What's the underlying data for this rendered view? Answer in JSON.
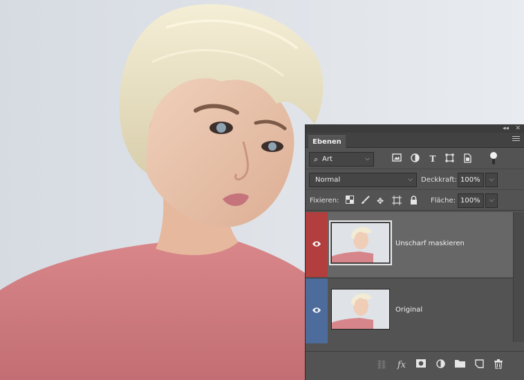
{
  "panel": {
    "collapse_glyph": "◂◂",
    "close_glyph": "✕",
    "tab_label": "Ebenen",
    "menu_icon": "panel-menu-icon"
  },
  "filter": {
    "kind_label": "Art",
    "kind_icon": "search-icon",
    "filter_icons": [
      "image-filter-icon",
      "adjustment-filter-icon",
      "type-filter-icon",
      "shape-filter-icon",
      "smart-object-filter-icon"
    ],
    "toggle_icon": "filter-toggle-icon"
  },
  "blend": {
    "mode": "Normal",
    "opacity_label": "Deckkraft:",
    "opacity_value": "100%"
  },
  "lock": {
    "label": "Fixieren:",
    "icons": [
      "lock-transparent-icon",
      "lock-image-icon",
      "lock-position-icon",
      "lock-artboard-icon",
      "lock-all-icon"
    ],
    "fill_label": "Fläche:",
    "fill_value": "100%"
  },
  "layers": [
    {
      "name": "Unscharf maskieren",
      "selected": true,
      "visible": true,
      "color_tag": "#b23e3e"
    },
    {
      "name": "Original",
      "selected": false,
      "visible": true,
      "color_tag": "#4d6b9b"
    }
  ],
  "footer_icons": [
    "link-layers-icon",
    "fx-icon",
    "add-mask-icon",
    "adjustment-layer-icon",
    "group-folder-icon",
    "new-layer-icon",
    "trash-icon"
  ],
  "footer_fx_label": "fx",
  "colors": {
    "panel_bg": "#535353",
    "selected_row": "#676767",
    "red_tag": "#b23e3e",
    "blue_tag": "#4d6b9b"
  }
}
